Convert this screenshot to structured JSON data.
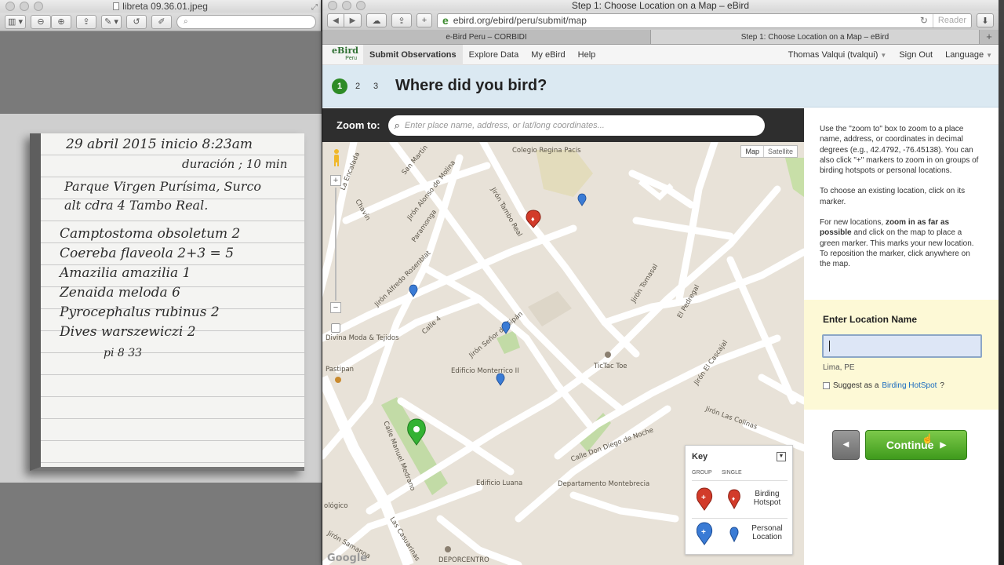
{
  "preview": {
    "title": "libreta 09.36.01.jpeg",
    "search_placeholder": "",
    "notes": {
      "line1": "29 abril 2015  inicio 8:23am",
      "line2": "duración ; 10 min",
      "line3": "Parque Virgen Purísima, Surco",
      "line4": "alt cdra 4 Tambo Real.",
      "species": [
        "Camptostoma obsoletum 2",
        "Coereba flaveola 2+3 = 5",
        "Amazilia amazilia 1",
        "Zenaida meloda 6",
        "Pyrocephalus rubinus 2",
        "Dives warszewiczi 2"
      ],
      "footer": "pi 8 33"
    }
  },
  "browser": {
    "window_title": "Step 1: Choose Location on a Map – eBird",
    "url": "ebird.org/ebird/peru/submit/map",
    "reader_label": "Reader",
    "tabs": [
      "e-Bird Peru – CORBIDI",
      "Step 1: Choose Location on a Map – eBird"
    ]
  },
  "ebird": {
    "logo_main": "eBird",
    "logo_sub": "Peru",
    "nav": [
      "Submit Observations",
      "Explore Data",
      "My eBird",
      "Help"
    ],
    "nav_right": {
      "user": "Thomas Valqui (tvalqui)",
      "signout": "Sign Out",
      "language": "Language"
    },
    "steps": [
      "1",
      "2",
      "3"
    ],
    "heading": "Where did you bird?",
    "zoom_label": "Zoom to:",
    "zoom_placeholder": "Enter place name, address, or lat/long coordinates...",
    "help": {
      "p1": "Use the \"zoom to\" box to zoom to a place name, address, or coordinates in decimal degrees (e.g., 42.4792, -76.45138). You can also click \"+\" markers to zoom in on groups of birding hotspots or personal locations.",
      "p2": "To choose an existing location, click on its marker.",
      "p3_a": "For new locations, ",
      "p3_bold": "zoom in as far as possible",
      "p3_b": " and click on the map to place a green marker. This marks your new location. To reposition the marker, click anywhere on the map."
    },
    "location": {
      "title": "Enter Location Name",
      "value": "",
      "place": "Lima, PE",
      "suggest_prefix": "Suggest as a ",
      "suggest_link": "Birding HotSpot",
      "suggest_suffix": "?"
    },
    "continue_label": "Continue"
  },
  "map": {
    "type_map": "Map",
    "type_satellite": "Satellite",
    "labels": {
      "colegio": "Colegio Regina Pacis",
      "san_martin": "San Martin",
      "alonso": "Jirón Alonso de Molina",
      "tambo": "Jirón Tambo Real",
      "encalada": "La Encalada",
      "chavin": "Chavín",
      "paramonga": "Paramonga",
      "rosenblat": "Jirón Alfredo Rosenblat",
      "calle4": "Calle 4",
      "senor": "Jirón Señor de Sipán",
      "tomasal": "Jirón Tomasal",
      "pedregal": "El Pedregal",
      "divina": "Divina Moda & Tejidos",
      "pastipan": "Pastipan",
      "edificio_monterrico": "Edificio Monterrico II",
      "tictac": "TicTac Toe",
      "cascajal": "Jirón El Cascajal",
      "colinas": "Jirón Las Colinas",
      "diego": "Calle Don Diego de Noche",
      "manuel": "Calle Manuel Medrano",
      "luana": "Edificio Luana",
      "depto": "Departamento Montebrecia",
      "casuarinas": "Las Casuarinas",
      "samanna": "Jirón Samanna",
      "deporcentro": "DEPORCENTRO",
      "ecologico": "ológico",
      "google": "Google"
    },
    "key": {
      "title": "Key",
      "group": "GROUP",
      "single": "SINGLE",
      "hotspot": "Birding Hotspot",
      "personal": "Personal Location"
    },
    "colors": {
      "hotspot": "#d23b2a",
      "personal": "#3a7bd5",
      "new": "#34b233"
    }
  }
}
